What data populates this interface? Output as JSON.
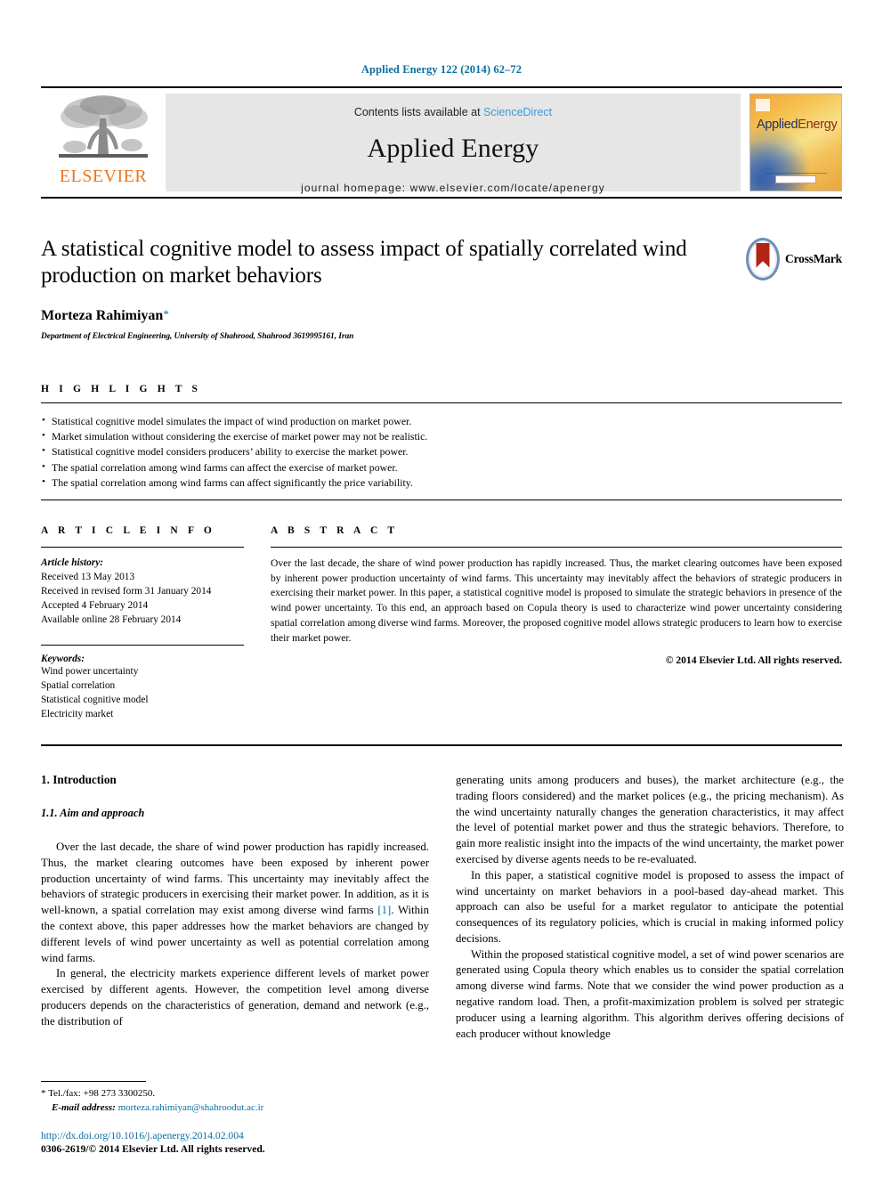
{
  "running_head": "Applied Energy 122 (2014) 62–72",
  "masthead": {
    "publisher_logo_text": "ELSEVIER",
    "contents_prefix": "Contents lists available at",
    "contents_link": "ScienceDirect",
    "journal_name": "Applied Energy",
    "homepage": "journal homepage: www.elsevier.com/locate/apenergy",
    "cover_title_a": "Applied",
    "cover_title_b": "Energy"
  },
  "article": {
    "title": "A statistical cognitive model to assess impact of spatially correlated wind production on market behaviors",
    "crossmark_label": "CrossMark",
    "author": "Morteza Rahimiyan",
    "author_marker": "*",
    "affiliation": "Department of Electrical Engineering, University of Shahrood, Shahrood 3619995161, Iran"
  },
  "highlights": {
    "label": "H I G H L I G H T S",
    "items": [
      "Statistical cognitive model simulates the impact of wind production on market power.",
      "Market simulation without considering the exercise of market power may not be realistic.",
      "Statistical cognitive model considers producers’ ability to exercise the market power.",
      "The spatial correlation among wind farms can affect the exercise of market power.",
      "The spatial correlation among wind farms can affect significantly the price variability."
    ]
  },
  "article_info": {
    "label": "A R T I C L E    I N F O",
    "history_title": "Article history:",
    "history": [
      "Received 13 May 2013",
      "Received in revised form 31 January 2014",
      "Accepted 4 February 2014",
      "Available online 28 February 2014"
    ],
    "keywords_title": "Keywords:",
    "keywords": [
      "Wind power uncertainty",
      "Spatial correlation",
      "Statistical cognitive model",
      "Electricity market"
    ]
  },
  "abstract": {
    "label": "A B S T R A C T",
    "text": "Over the last decade, the share of wind power production has rapidly increased. Thus, the market clearing outcomes have been exposed by inherent power production uncertainty of wind farms. This uncertainty may inevitably affect the behaviors of strategic producers in exercising their market power. In this paper, a statistical cognitive model is proposed to simulate the strategic behaviors in presence of the wind power uncertainty. To this end, an approach based on Copula theory is used to characterize wind power uncertainty considering spatial correlation among diverse wind farms. Moreover, the proposed cognitive model allows strategic producers to learn how to exercise their market power.",
    "copyright": "© 2014 Elsevier Ltd. All rights reserved."
  },
  "body": {
    "section_title": "1. Introduction",
    "subsection_title": "1.1. Aim and approach",
    "left_paragraphs": [
      {
        "before": "Over the last decade, the share of wind power production has rapidly increased. Thus, the market clearing outcomes have been exposed by inherent power production uncertainty of wind farms. This uncertainty may inevitably affect the behaviors of strategic producers in exercising their market power. In addition, as it is well-known, a spatial correlation may exist among diverse wind farms ",
        "ref": "[1]",
        "after": ". Within the context above, this paper addresses how the market behaviors are changed by different levels of wind power uncertainty as well as potential correlation among wind farms."
      },
      {
        "before": "In general, the electricity markets experience different levels of market power exercised by different agents. However, the competition level among diverse producers depends on the characteristics of generation, demand and network (e.g., the distribution of",
        "ref": "",
        "after": ""
      }
    ],
    "right_paragraphs": [
      "generating units among producers and buses), the market architecture (e.g., the trading floors considered) and the market polices (e.g., the pricing mechanism). As the wind uncertainty naturally changes the generation characteristics, it may affect the level of potential market power and thus the strategic behaviors. Therefore, to gain more realistic insight into the impacts of the wind uncertainty, the market power exercised by diverse agents needs to be re-evaluated.",
      "In this paper, a statistical cognitive model is proposed to assess the impact of wind uncertainty on market behaviors in a pool-based day-ahead market. This approach can also be useful for a market regulator to anticipate the potential consequences of its regulatory policies, which is crucial in making informed policy decisions.",
      "Within the proposed statistical cognitive model, a set of wind power scenarios are generated using Copula theory which enables us to consider the spatial correlation among diverse wind farms. Note that we consider the wind power production as a negative random load. Then, a profit-maximization problem is solved per strategic producer using a learning algorithm. This algorithm derives offering decisions of each producer without knowledge"
    ]
  },
  "footnote": {
    "marker": "*",
    "tel": "Tel./fax: +98 273 3300250.",
    "email_label": "E-mail address:",
    "email": "morteza.rahimiyan@shahroodut.ac.ir"
  },
  "footer": {
    "doi": "http://dx.doi.org/10.1016/j.apenergy.2014.02.004",
    "issn_line": "0306-2619/© 2014 Elsevier Ltd. All rights reserved."
  },
  "colors": {
    "link_blue": "#0b6e9e",
    "sciencedirect_blue": "#3a9ad9",
    "elsevier_orange": "#E87722",
    "crossmark_red": "#b32317"
  }
}
